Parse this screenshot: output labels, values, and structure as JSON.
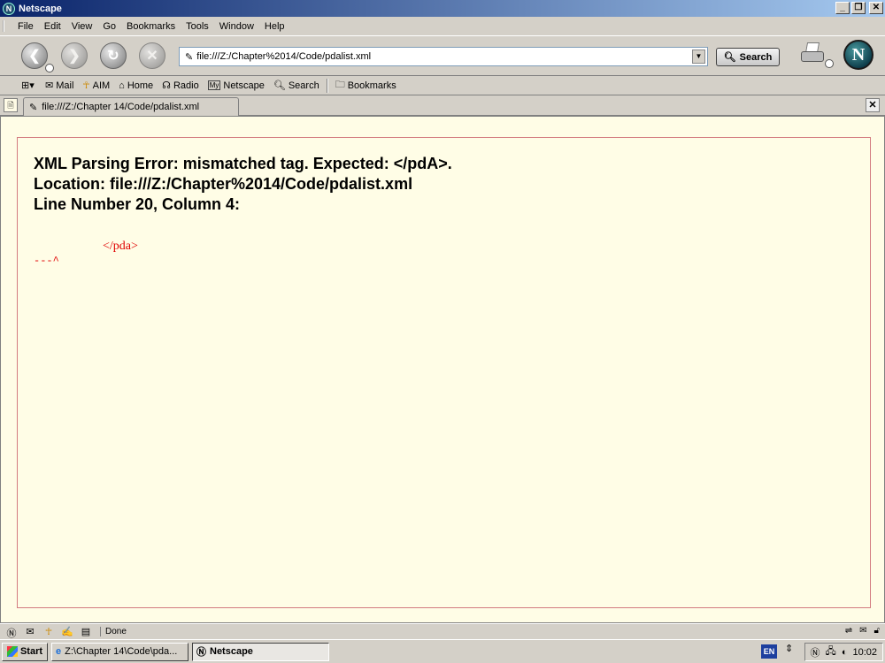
{
  "window": {
    "title": "Netscape"
  },
  "menu": {
    "items": [
      {
        "label": "File"
      },
      {
        "label": "Edit"
      },
      {
        "label": "View"
      },
      {
        "label": "Go"
      },
      {
        "label": "Bookmarks"
      },
      {
        "label": "Tools"
      },
      {
        "label": "Window"
      },
      {
        "label": "Help"
      }
    ]
  },
  "nav": {
    "url_value": "file:///Z:/Chapter%2014/Code/pdalist.xml",
    "search_label": "Search"
  },
  "personal_toolbar": {
    "items": [
      {
        "label": "Mail",
        "icon": "mail-icon"
      },
      {
        "label": "AIM",
        "icon": "aim-icon"
      },
      {
        "label": "Home",
        "icon": "home-icon"
      },
      {
        "label": "Radio",
        "icon": "radio-icon"
      },
      {
        "label": "Netscape",
        "icon": "my-netscape-icon"
      },
      {
        "label": "Search",
        "icon": "search-icon"
      },
      {
        "label": "Bookmarks",
        "icon": "bookmarks-icon"
      }
    ]
  },
  "tab": {
    "label": "file:///Z:/Chapter 14/Code/pdalist.xml"
  },
  "error": {
    "line1": "XML Parsing Error: mismatched tag. Expected: </pdA>.",
    "line2": "Location: file:///Z:/Chapter%2014/Code/pdalist.xml",
    "line3": "Line Number 20, Column 4:",
    "source": "</pda>",
    "pointer": "---^"
  },
  "status": {
    "text": "Done"
  },
  "taskbar": {
    "start_label": "Start",
    "tasks": [
      {
        "label": "Z:\\Chapter 14\\Code\\pda...",
        "active": false
      },
      {
        "label": "Netscape",
        "active": true
      }
    ],
    "language": "EN",
    "clock": "10:02"
  },
  "colors": {
    "error_text": "#e00000",
    "content_bg": "#fffde6",
    "error_border": "#d37b80"
  }
}
